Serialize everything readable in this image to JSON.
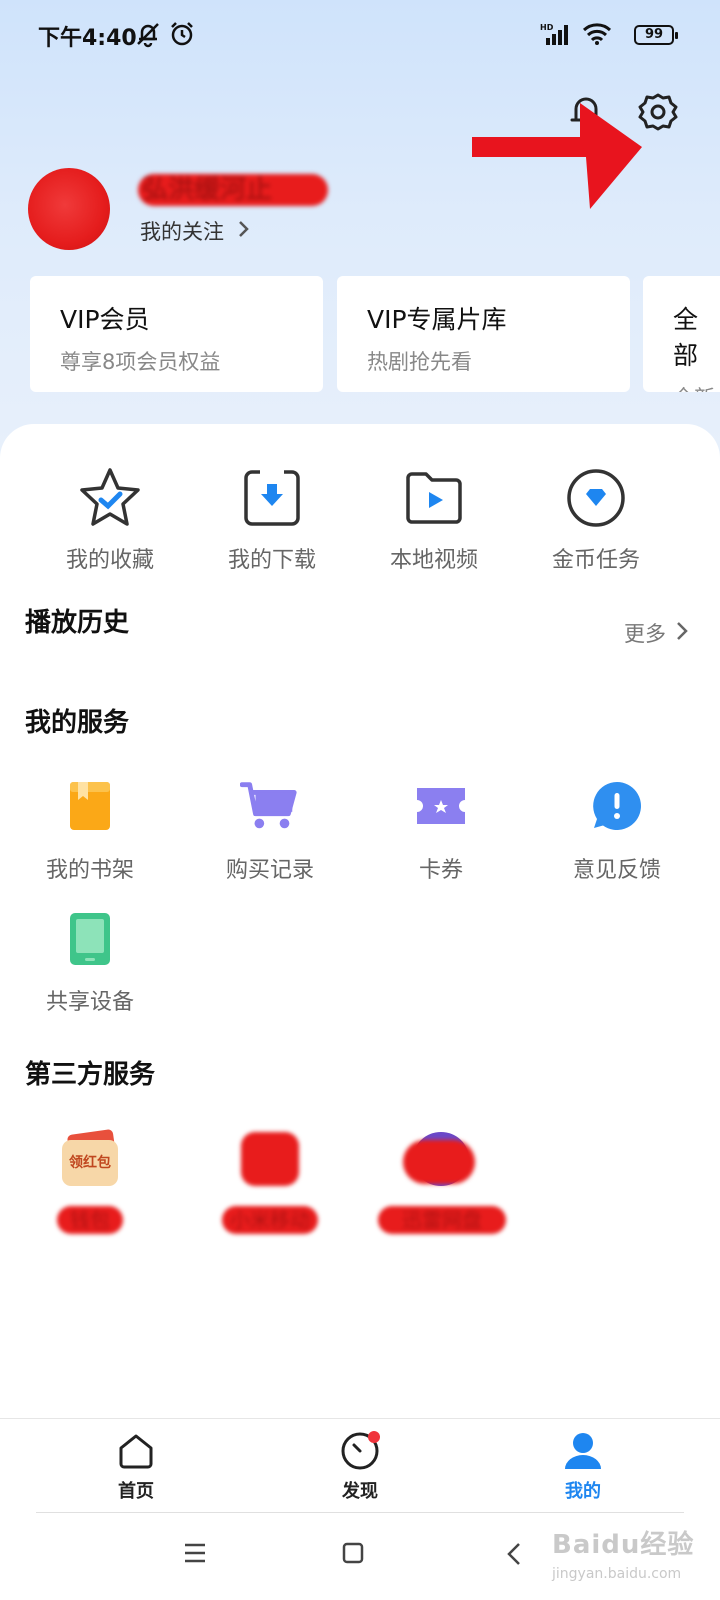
{
  "status_bar": {
    "time": "下午4:40",
    "signal_label": "HD",
    "battery": "99"
  },
  "header": {
    "notification_icon": "bell-icon",
    "settings_icon": "gear-icon"
  },
  "profile": {
    "username": "弘洪缓河止",
    "follow_label": "我的关注"
  },
  "vip_cards": [
    {
      "title": "VIP会员",
      "subtitle": "尊享8项会员权益"
    },
    {
      "title": "VIP专属片库",
      "subtitle": "热剧抢先看"
    },
    {
      "title": "全部",
      "subtitle": "全新"
    }
  ],
  "quick_actions": [
    {
      "label": "我的收藏",
      "icon": "star-icon"
    },
    {
      "label": "我的下载",
      "icon": "download-icon"
    },
    {
      "label": "本地视频",
      "icon": "folder-play-icon"
    },
    {
      "label": "金币任务",
      "icon": "diamond-icon"
    }
  ],
  "history": {
    "title": "播放历史",
    "more_label": "更多"
  },
  "services": {
    "title": "我的服务",
    "items": [
      {
        "label": "我的书架",
        "icon": "bookshelf-icon"
      },
      {
        "label": "购买记录",
        "icon": "cart-icon"
      },
      {
        "label": "卡券",
        "icon": "ticket-icon"
      },
      {
        "label": "意见反馈",
        "icon": "feedback-icon"
      },
      {
        "label": "共享设备",
        "icon": "device-icon"
      }
    ]
  },
  "third_party": {
    "title": "第三方服务",
    "items": [
      {
        "badge": "领红包",
        "label": "钱包"
      },
      {
        "label": "小米移动"
      },
      {
        "label": "迅雷网盘"
      }
    ]
  },
  "bottom_nav": [
    {
      "label": "首页",
      "icon": "home-icon"
    },
    {
      "label": "发现",
      "icon": "compass-icon"
    },
    {
      "label": "我的",
      "icon": "user-icon"
    }
  ],
  "watermark": {
    "brand": "Baidu经验",
    "url": "jingyan.baidu.com"
  },
  "colors": {
    "accent": "#1e86f0",
    "annotation_red": "#e8141e",
    "background_top": "#d3e5fb"
  }
}
